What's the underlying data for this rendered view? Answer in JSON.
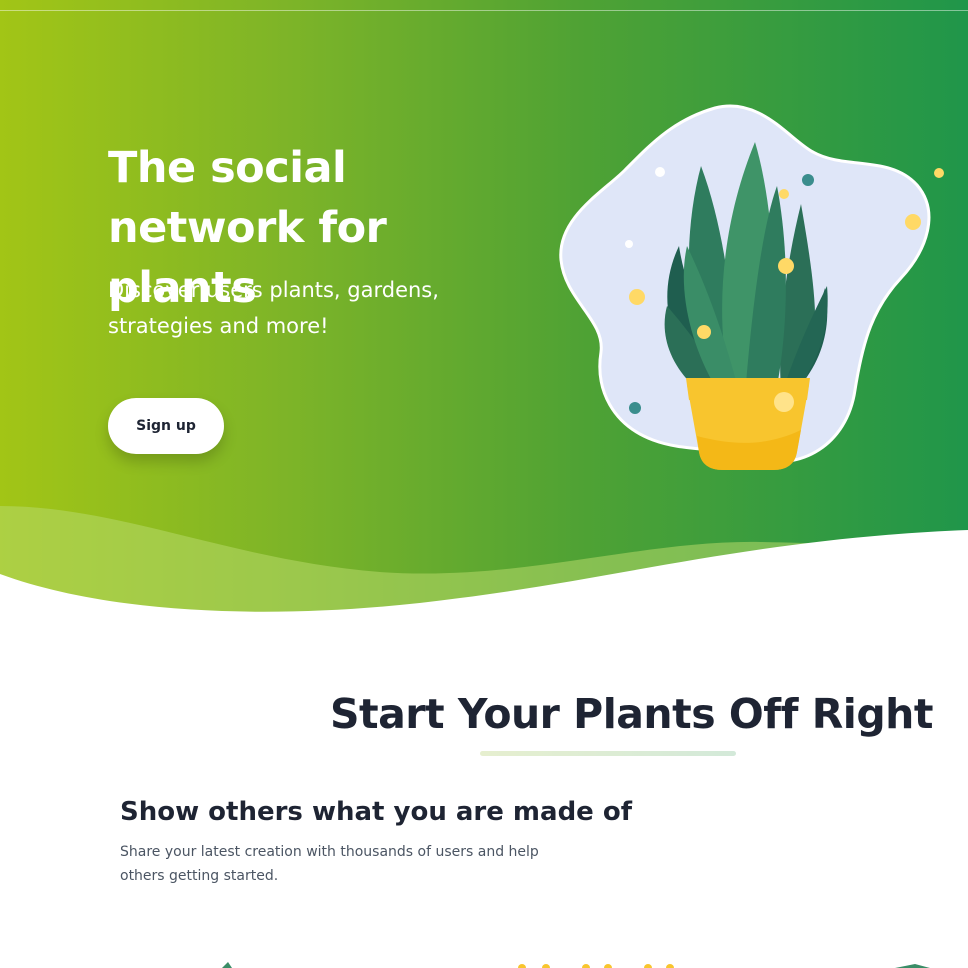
{
  "hero": {
    "title": "The social network for plants",
    "subtitle": "Discover users plants, gardens, strategies and more!",
    "signup_label": "Sign up",
    "illustration_icon": "potted-plant-illustration"
  },
  "section": {
    "title": "Start Your Plants Off Right"
  },
  "feature": {
    "title": "Show others what you are made of",
    "text": "Share your latest creation with thousands of users and help others getting started."
  },
  "colors": {
    "gradient_start": "#a2c516",
    "gradient_end": "#20964a",
    "heading": "#1e2433",
    "body_text": "#4b5563",
    "pot": "#f8c52e",
    "leaf_dark": "#1f5e4f",
    "leaf_mid": "#3a8d67",
    "blob": "#dfe6f8"
  }
}
